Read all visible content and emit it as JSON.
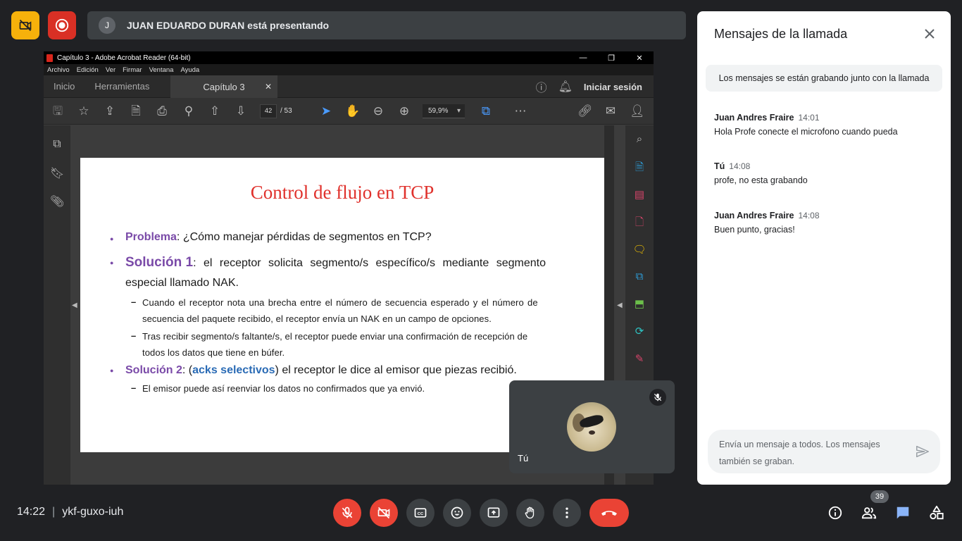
{
  "topbar": {
    "presenter_initial": "J",
    "presenting_text": "JUAN EDUARDO DURAN está presentando"
  },
  "acrobat": {
    "window_title": "Capítulo 3 - Adobe Acrobat Reader (64-bit)",
    "menu": [
      "Archivo",
      "Edición",
      "Ver",
      "Firmar",
      "Ventana",
      "Ayuda"
    ],
    "tabs": {
      "home": "Inicio",
      "tools": "Herramientas",
      "document": "Capítulo 3"
    },
    "sign_in": "Iniciar sesión",
    "page_current": "42",
    "page_total": "/ 53",
    "zoom": "59,9%"
  },
  "slide": {
    "title": "Control de flujo en TCP",
    "p1_label": "Problema",
    "p1_text": ": ¿Cómo manejar pérdidas de segmentos en TCP?",
    "s1_label": "Solución 1",
    "s1_text_a": ": el receptor solicita segmento/s específico/s mediante segmento",
    "s1_text_b": "especial llamado NAK.",
    "s1_sub1_a": "Cuando el receptor nota una brecha entre el número de secuencia esperado y el número de",
    "s1_sub1_b": "secuencia del paquete recibido, el receptor envía un NAK en un campo de opciones.",
    "s1_sub2_a": "Tras recibir segmento/s faltante/s, el receptor puede enviar una confirmación de recepción de",
    "s1_sub2_b": "todos los datos que tiene en búfer.",
    "s2_label": "Solución 2",
    "s2_colon": ":  (",
    "s2_highlight": "acks selectivos",
    "s2_text": ") el receptor le dice al emisor que piezas recibió.",
    "s2_sub1": "El emisor puede así reenviar los datos no confirmados que ya envió."
  },
  "self_tile": {
    "name": "Tú"
  },
  "chat": {
    "title": "Mensajes de la llamada",
    "recording_note": "Los mensajes se están grabando junto con la llamada",
    "messages": [
      {
        "sender": "Juan Andres Fraire",
        "time": "14:01",
        "text": "Hola Profe conecte el microfono cuando pueda"
      },
      {
        "sender": "Tú",
        "time": "14:08",
        "text": "profe, no esta grabando"
      },
      {
        "sender": "Juan Andres Fraire",
        "time": "14:08",
        "text": "Buen punto, gracias!"
      }
    ],
    "input_placeholder": "Envía un mensaje a todos. Los mensajes también se graban."
  },
  "bottom": {
    "time": "14:22",
    "meeting_code": "ykf-guxo-iuh",
    "participants_count": "39"
  },
  "colors": {
    "meet_bg": "#202124",
    "accent_red": "#ea4335",
    "accent_yellow": "#f6b10b",
    "chat_blue": "#1a73e8",
    "slide_title_red": "#e0312c",
    "slide_purple": "#7a4aa8"
  }
}
